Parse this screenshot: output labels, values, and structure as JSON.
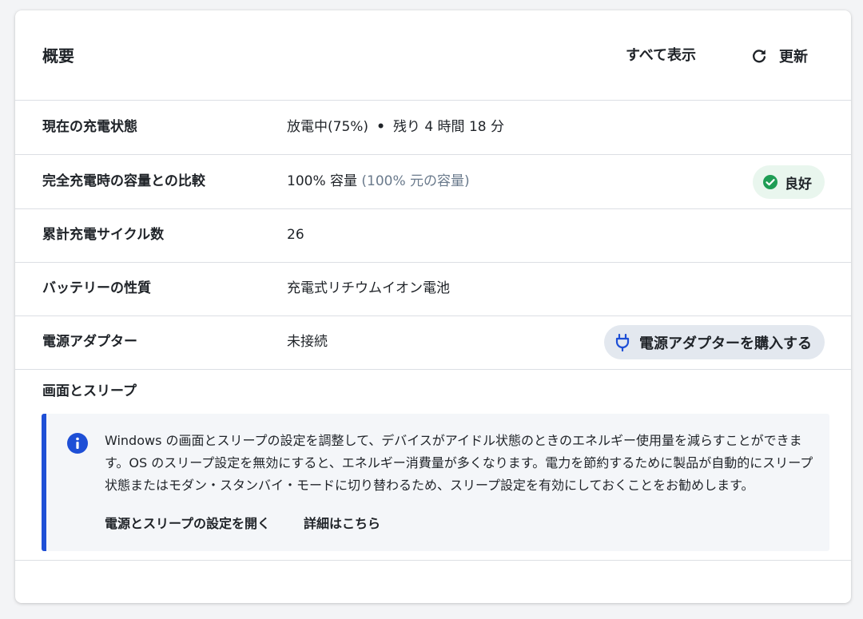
{
  "header": {
    "title": "概要",
    "show_all_label": "すべて表示",
    "refresh_label": "更新",
    "refresh_icon": "refresh-icon"
  },
  "rows": [
    {
      "label": "現在の充電状態",
      "value": "放電中(75%)",
      "separator": "•",
      "extra": "残り 4 時間 18 分"
    },
    {
      "label": "完全充電時の容量との比較",
      "value": "100% 容量",
      "muted": "(100% 元の容量)",
      "badge": {
        "label": "良好",
        "icon": "check-circle-icon",
        "color": "#1f9d55",
        "background": "#e9f6ee"
      }
    },
    {
      "label": "累計充電サイクル数",
      "value": "26"
    },
    {
      "label": "バッテリーの性質",
      "value": "充電式リチウムイオン電池"
    },
    {
      "label": "電源アダプター",
      "value": "未接続",
      "button": {
        "label": "電源アダプターを購入する",
        "icon": "plug-icon",
        "background": "#e3e8ef"
      }
    }
  ],
  "sleep": {
    "title": "画面とスリープ",
    "info_icon": "info-icon",
    "accent_color": "#1e4fd6",
    "text": "Windows の画面とスリープの設定を調整して、デバイスがアイドル状態のときのエネルギー使用量を減らすことができます。OS のスリープ設定を無効にすると、エネルギー消費量が多くなります。電力を節約するために製品が自動的にスリープ状態またはモダン・スタンバイ・モードに切り替わるため、スリープ設定を有効にしておくことをお勧めします。",
    "links": [
      "電源とスリープの設定を開く",
      "詳細はこちら"
    ]
  }
}
